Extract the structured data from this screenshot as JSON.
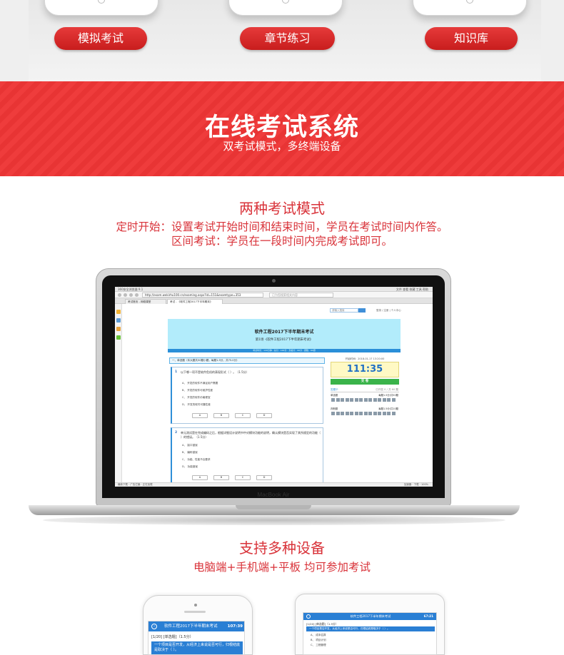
{
  "top": {
    "buttons": [
      "模拟考试",
      "章节练习",
      "知识库"
    ]
  },
  "banner": {
    "title": "在线考试系统",
    "subtitle": "双考试模式，多终端设备",
    "color": "#ef3c3c"
  },
  "modes": {
    "title": "两种考试模式",
    "line1": "定时开始：设置考试开始时间和结束时间，学员在考试时间内作答。",
    "line2": "区间考试：学员在一段时间内完成考试即可。",
    "color": "#d9333a"
  },
  "laptop": {
    "brand": "MacBook Air",
    "browser": {
      "title": "360安全浏览器 9.1",
      "menu": "文件  查看  收藏  工具  帮助",
      "url": "http://exam.wekirhu100.cn/examing.aspx?id=151&examtype=353",
      "search": "已为您搜索相关内容",
      "tabs": [
        "考试首页 - 网络课堂",
        "考试 - 《软件工程2017下半年期末》"
      ],
      "status_left": "最新下载  ·  广告拦截  ·  正在加载",
      "status_right": "加速器  ·  下载  ·  100%"
    },
    "page": {
      "search_placeholder": "请输入搜索",
      "login": "登录 / 注册 | 个人中心",
      "exam_title": "软件工程2017下半年期末考试",
      "exam_sub": "第1场 ·《软件工程2017下半年期末考试》",
      "info_bar": "考试时长：120分钟  ·  总分：100分  ·  及格分：60分  ·  题数：60题",
      "section": "一、单选题（本大题共50题小题，每题1.5分，共75.0分）",
      "questions": [
        {
          "num": "1",
          "stem": "以下哪一项不是软件危机的表现形式（  ）。（1.5分）",
          "options": [
            "A、 开发的软件不满足用户需要",
            "B、 开发的软件可维护性差",
            "C、 开发的软件价格便宜",
            "D、 开发的软件可靠性差"
          ]
        },
        {
          "num": "2",
          "stem": "单元测试是在完成编码之后，根据详细设计说明书中对模块功能的说明，确认模块是否实现了其所规定的功能（  ）的错误。（1.5分）",
          "options": [
            "A、 接口错误",
            "B、 编码错误",
            "C、 功能、性能不合要求",
            "D、 功能错误"
          ]
        }
      ],
      "choices": [
        "A",
        "B",
        "C",
        "D"
      ],
      "timer_caption": "开始时间：2018-01-17 13:20:00",
      "timer": "111:35",
      "submit": "交 卷",
      "answer_card": "答题卡",
      "answer_card_right": "已作答 0 / 共 60 题",
      "group1": "单选题",
      "group1_right": "每题1.5分/共50题",
      "group2": "判断题",
      "group2_right": "每题1.5分/共10题"
    }
  },
  "devices": {
    "title": "支持多种设备",
    "line": "电脑端+手机端+平板  均可参加考试",
    "phone": {
      "title": "软件工程2017下半年期末考试",
      "timer": "107:39",
      "question_meta": "[1/20] [单选题]（1.5分）",
      "stem": "一个项目是否开发，从经济上来说是否可行，归根结底是取决于（  ）。"
    },
    "tablet": {
      "title": "软件工程2017下半年期末考试",
      "timer": "67:21",
      "question_meta": "[1/20] [单选题]（1.5分）",
      "stem": "一个项目是否开发，从经济上来说是否可行，归根结底是取决于（  ）。",
      "options": [
        "A、 成本估算",
        "B、 项目计划",
        "C、 工程管理"
      ]
    }
  }
}
